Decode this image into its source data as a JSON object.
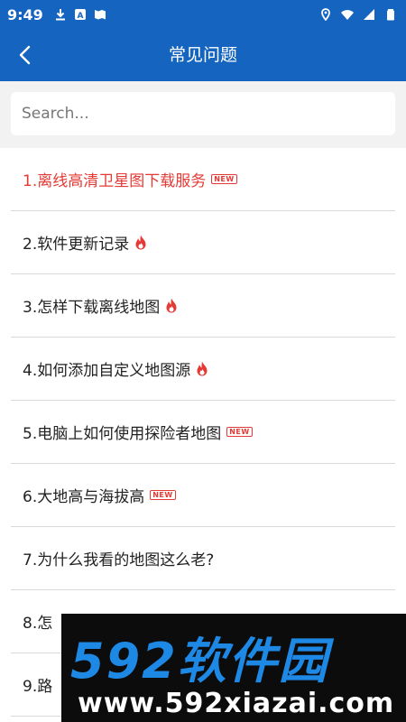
{
  "status_bar": {
    "time": "9:49",
    "left_icons": [
      "download-icon",
      "translate-icon",
      "map-icon"
    ],
    "right_icons": [
      "location-icon",
      "wifi-icon",
      "signal-icon",
      "battery-icon"
    ]
  },
  "app_bar": {
    "title": "常见问题",
    "back_icon": "chevron-left-icon"
  },
  "search": {
    "placeholder": "Search..."
  },
  "faq_items": [
    {
      "label": "1.离线高清卫星图下载服务",
      "badge": "NEW",
      "highlighted": true
    },
    {
      "label": "2.软件更新记录",
      "badge": "hot"
    },
    {
      "label": "3.怎样下载离线地图",
      "badge": "hot"
    },
    {
      "label": "4.如何添加自定义地图源",
      "badge": "hot"
    },
    {
      "label": "5.电脑上如何使用探险者地图",
      "badge": "NEW"
    },
    {
      "label": "6.大地高与海拔高",
      "badge": "NEW"
    },
    {
      "label": "7.为什么我看的地图这么老?"
    },
    {
      "label": "8.怎"
    },
    {
      "label": "9.路"
    }
  ],
  "watermark": {
    "logo": "592软件园",
    "url": "www.592xiazai.com"
  },
  "colors": {
    "primary": "#1565c0",
    "highlight": "#e53935",
    "watermark_logo": "#1e88e5"
  }
}
